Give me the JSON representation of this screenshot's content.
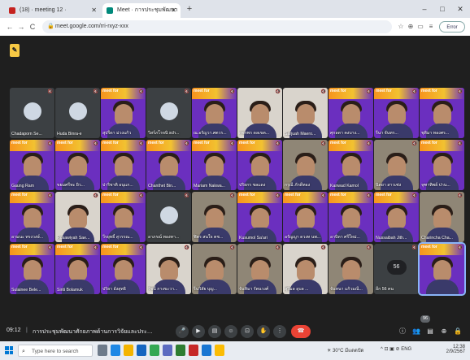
{
  "browser": {
    "tabs": [
      {
        "label": "(18) · meeting 12 ·",
        "favicon_color": "#c5221f",
        "active": false
      },
      {
        "label": "Meet · การประชุมพัฒนา",
        "favicon_color": "#00897b",
        "active": true
      }
    ],
    "new_tab": "+",
    "window": {
      "minimize": "–",
      "maximize": "□",
      "close": "✕"
    },
    "nav": {
      "back": "←",
      "forward": "→",
      "reload": "C"
    },
    "url": "meet.google.com/rri-rxyz-xxx",
    "lock": "🔒",
    "extensions": [
      "☆",
      "⊕",
      "▭",
      "≡"
    ],
    "profile_label": "Error"
  },
  "meet": {
    "notes_badge": "✎",
    "tile_tag": "meet for",
    "participants": [
      {
        "name": "Chadaporn Se...",
        "style": "dark",
        "kind": "avatar"
      },
      {
        "name": "Huda Binra-e",
        "style": "dark",
        "kind": "avatar"
      },
      {
        "name": "สุปรีดา ม่วงแก้ว",
        "style": "purple",
        "kind": "person"
      },
      {
        "name": "วิสร์ภโรจนิ sch...",
        "style": "dark",
        "kind": "avatar"
      },
      {
        "name": "ณ.อรัญวา.ศตวร...",
        "style": "purple",
        "kind": "person"
      },
      {
        "name": "กชกพร ดลเขต...",
        "style": "light",
        "kind": "person"
      },
      {
        "name": "Sarjuah Maero...",
        "style": "light",
        "kind": "person"
      },
      {
        "name": "ศุกลดา คงบาง...",
        "style": "purple",
        "kind": "person"
      },
      {
        "name": "รีนา จันทร...",
        "style": "purple",
        "kind": "person"
      },
      {
        "name": "ชุติมา ทองศร...",
        "style": "purple",
        "kind": "person"
      },
      {
        "name": "Gaung Ram",
        "style": "purple",
        "kind": "person"
      },
      {
        "name": "ขยมศรีทะ ผิว...",
        "style": "purple",
        "kind": "person"
      },
      {
        "name": "ปาริชาติ อนุแก...",
        "style": "purple",
        "kind": "person"
      },
      {
        "name": "Chanthet Bin...",
        "style": "purple",
        "kind": "person"
      },
      {
        "name": "Mariam Nakwa...",
        "style": "purple",
        "kind": "person"
      },
      {
        "name": "ปริยกร ชลแดง",
        "style": "purple",
        "kind": "person"
      },
      {
        "name": "กรุณี ภักดีทอง",
        "style": "room",
        "kind": "person"
      },
      {
        "name": "Kanwad Kamol",
        "style": "purple",
        "kind": "person"
      },
      {
        "name": "นิตยา สาวเซ่ง",
        "style": "room",
        "kind": "person"
      },
      {
        "name": "จุฑาทิพย์ ปาน...",
        "style": "purple",
        "kind": "person"
      },
      {
        "name": "อามนะ ทรงวงษ์...",
        "style": "purple",
        "kind": "person"
      },
      {
        "name": "Rosawiyah Sae...",
        "style": "light",
        "kind": "person"
      },
      {
        "name": "วีรยุทธิ์ สุวรรณ...",
        "style": "purple",
        "kind": "person"
      },
      {
        "name": "อาภรณ์ ทองทา...",
        "style": "dark",
        "kind": "avatar"
      },
      {
        "name": "ฟิตร สนใจ ตช...",
        "style": "room",
        "kind": "person"
      },
      {
        "name": "Kusumol Sa'ari",
        "style": "purple",
        "kind": "person"
      },
      {
        "name": "อรัญญา ดวงท นพ...",
        "style": "purple",
        "kind": "person"
      },
      {
        "name": "อาบิดา ศรีใหม่...",
        "style": "purple",
        "kind": "person"
      },
      {
        "name": "Nussaibah Jith...",
        "style": "purple",
        "kind": "person"
      },
      {
        "name": "Charincha Cha...",
        "style": "room",
        "kind": "person"
      },
      {
        "name": "Sulainee Bele...",
        "style": "purple",
        "kind": "person"
      },
      {
        "name": "Siriti Bolamuk",
        "style": "purple",
        "kind": "person"
      },
      {
        "name": "ปริยา อังสุทธิ",
        "style": "purple",
        "kind": "person"
      },
      {
        "name": "รัชนี กางขะวา...",
        "style": "light",
        "kind": "person"
      },
      {
        "name": "รีนวิสัย บุญ...",
        "style": "room",
        "kind": "person"
      },
      {
        "name": "จันทิมา รัตนวงศ์",
        "style": "room",
        "kind": "person"
      },
      {
        "name": "สุวิมล อุบล ...",
        "style": "light",
        "kind": "person"
      },
      {
        "name": "จันทนา แก้วมณี...",
        "style": "room",
        "kind": "person"
      },
      {
        "name": "อีก 56 คน",
        "style": "dark",
        "kind": "more",
        "pill": "56"
      },
      {
        "name": "",
        "style": "purple",
        "kind": "person",
        "self": true
      }
    ]
  },
  "bottombar": {
    "time": "09:12",
    "separator": "|",
    "meeting_title": "การประชุมพัฒนาศักยภาพด้านการวิจัยและประเมินผลในพื้นที่...",
    "controls": [
      {
        "icon": "mic-icon",
        "glyph": "🎤"
      },
      {
        "icon": "camera-icon",
        "glyph": "▶"
      },
      {
        "icon": "captions-icon",
        "glyph": "▤"
      },
      {
        "icon": "emoji-icon",
        "glyph": "☺"
      },
      {
        "icon": "present-icon",
        "glyph": "⊡"
      },
      {
        "icon": "raise-hand-icon",
        "glyph": "✋"
      },
      {
        "icon": "more-icon",
        "glyph": "⋮"
      }
    ],
    "end_call_glyph": "☎",
    "right_controls": [
      {
        "icon": "info-icon",
        "glyph": "ⓘ"
      },
      {
        "icon": "people-icon",
        "glyph": "👥"
      },
      {
        "icon": "chat-icon",
        "glyph": "▤"
      },
      {
        "icon": "activities-icon",
        "glyph": "⊕"
      },
      {
        "icon": "lock-icon",
        "glyph": "🔒"
      }
    ],
    "participant_count": "96"
  },
  "taskbar": {
    "search_placeholder": "Type here to search",
    "search_icon": "⌕",
    "apps": [
      {
        "icon": "task-view-icon",
        "color": "#6e7b8b"
      },
      {
        "icon": "edge-icon",
        "color": "#1e88e5"
      },
      {
        "icon": "file-explorer-icon",
        "color": "#f4b400"
      },
      {
        "icon": "mail-icon",
        "color": "#1565c0"
      },
      {
        "icon": "chrome-icon",
        "color": "#34a853"
      },
      {
        "icon": "store-icon",
        "color": "#5c6bc0"
      },
      {
        "icon": "green-app-icon",
        "color": "#2e7d32"
      },
      {
        "icon": "red-app-icon",
        "color": "#c62828"
      },
      {
        "icon": "blue-app-icon",
        "color": "#1976d2"
      },
      {
        "icon": "chrome-2-icon",
        "color": "#fbbc04"
      }
    ],
    "weather": "☀ 30°C มีแดดปัด",
    "tray": "^ ⊡ ▣ ⊘ ENG",
    "clock": "12:38",
    "date": "2/9/2567"
  }
}
